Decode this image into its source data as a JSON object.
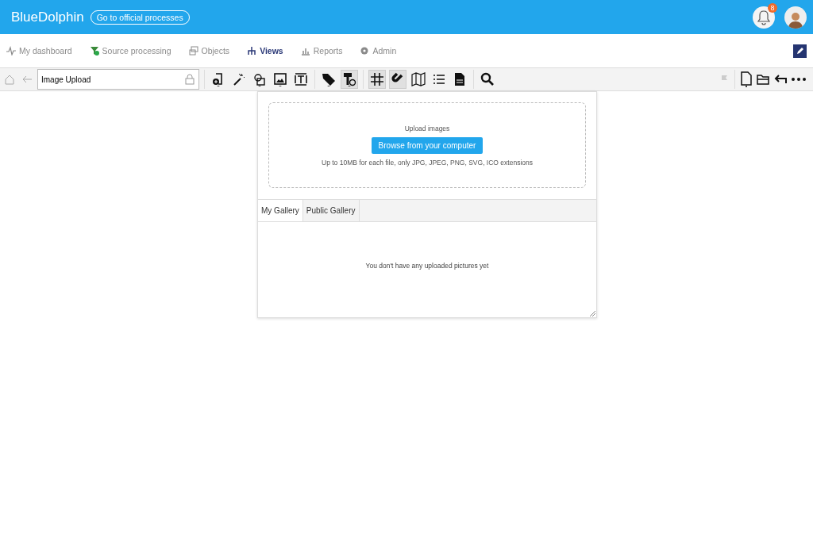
{
  "header": {
    "brand": "BlueDolphin",
    "process_link": "Go to official processes",
    "notification_count": "8"
  },
  "nav": [
    {
      "label": "My dashboard",
      "kind": "pulse",
      "selected": false
    },
    {
      "label": "Source processing",
      "kind": "funnel",
      "selected": false
    },
    {
      "label": "Objects",
      "kind": "objects",
      "selected": false
    },
    {
      "label": "Views",
      "kind": "views",
      "selected": true
    },
    {
      "label": "Reports",
      "kind": "chart",
      "selected": false
    },
    {
      "label": "Admin",
      "kind": "gear",
      "selected": false
    }
  ],
  "toolbar": {
    "view_name": "Image Upload",
    "tool_groups": [
      [
        {
          "kind": "doc-plus",
          "pressed": false,
          "dropdown": true
        },
        {
          "kind": "wand",
          "pressed": false,
          "dropdown": false
        },
        {
          "kind": "shapes",
          "pressed": false,
          "dropdown": true
        },
        {
          "kind": "image",
          "pressed": false,
          "dropdown": true
        },
        {
          "kind": "text",
          "pressed": false,
          "dropdown": false
        }
      ],
      [
        {
          "kind": "tag",
          "pressed": false,
          "dropdown": true
        },
        {
          "kind": "roller",
          "pressed": true,
          "dropdown": true
        }
      ],
      [
        {
          "kind": "grid",
          "pressed": true,
          "dropdown": false
        },
        {
          "kind": "magnet",
          "pressed": true,
          "dropdown": false
        },
        {
          "kind": "map",
          "pressed": false,
          "dropdown": false
        },
        {
          "kind": "list",
          "pressed": false,
          "dropdown": false
        },
        {
          "kind": "file",
          "pressed": false,
          "dropdown": false
        }
      ],
      [
        {
          "kind": "search",
          "pressed": false,
          "dropdown": false
        }
      ]
    ]
  },
  "upload": {
    "title": "Upload images",
    "button": "Browse from your computer",
    "hint": "Up to 10MB for each file, only JPG, JPEG, PNG, SVG, ICO extensions"
  },
  "gallery_tabs": [
    {
      "label": "My Gallery",
      "selected": true
    },
    {
      "label": "Public Gallery",
      "selected": false
    }
  ],
  "empty_message": "You don't have any uploaded pictures yet"
}
